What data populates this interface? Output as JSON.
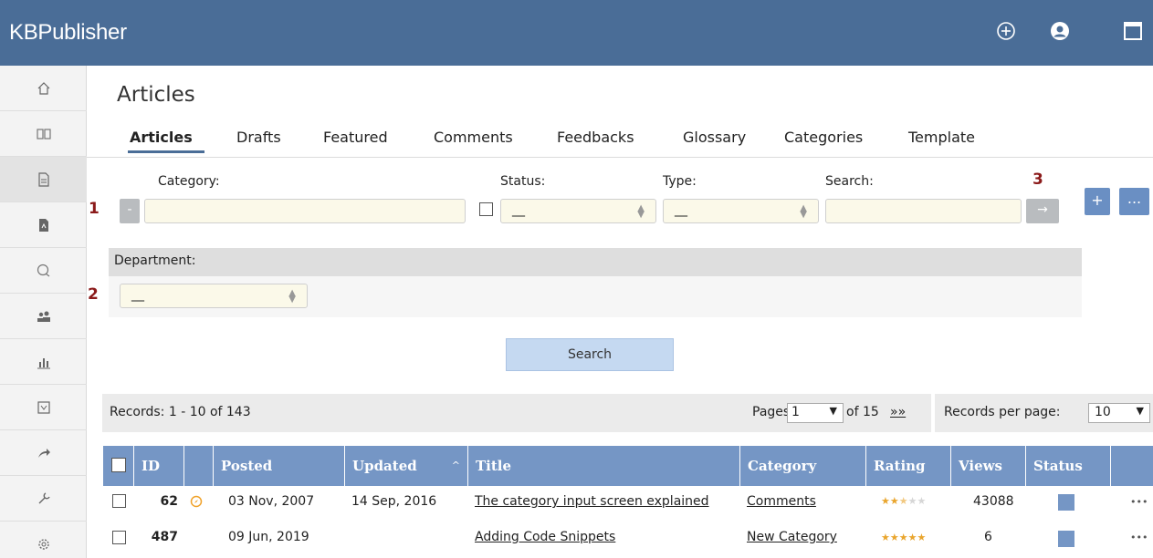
{
  "app": {
    "title": "KBPublisher"
  },
  "header": {
    "icons": [
      "plus-circle-icon",
      "user-icon",
      "window-icon"
    ]
  },
  "sidebar": {
    "items": [
      {
        "icon": "home-icon"
      },
      {
        "icon": "book-icon"
      },
      {
        "icon": "document-icon",
        "active": true
      },
      {
        "icon": "file-icon"
      },
      {
        "icon": "chat-icon"
      },
      {
        "icon": "users-icon"
      },
      {
        "icon": "chart-icon"
      },
      {
        "icon": "report-icon"
      },
      {
        "icon": "share-icon"
      },
      {
        "icon": "wrench-icon"
      },
      {
        "icon": "gear-icon"
      }
    ]
  },
  "page": {
    "title": "Articles",
    "tabs": [
      "Articles",
      "Drafts",
      "Featured",
      "Comments",
      "Feedbacks",
      "Glossary",
      "Categories",
      "Template"
    ],
    "active_tab": "Articles"
  },
  "filters": {
    "category_label": "Category:",
    "status_label": "Status:",
    "status_value": "__",
    "type_label": "Type:",
    "type_value": "__",
    "search_label": "Search:",
    "minus_label": "-",
    "go_label": "→",
    "add_label": "+",
    "more_label": "...",
    "department_label": "Department:",
    "department_value": "__",
    "search_button": "Search",
    "markers": [
      "1",
      "2",
      "3"
    ]
  },
  "pager": {
    "records_text": "Records: 1 - 10 of 143",
    "pages_label": "Pages:",
    "page_value": "1",
    "of_text": "of 15",
    "next_label": "»»",
    "rpp_label": "Records per page:",
    "rpp_value": "10"
  },
  "table": {
    "headers": [
      "ID",
      "Posted",
      "Updated",
      "Title",
      "Category",
      "Rating",
      "Views",
      "Status"
    ],
    "rows": [
      {
        "id": "62",
        "posted": "03 Nov, 2007",
        "updated": "14 Sep, 2016",
        "title": "The category input screen explained",
        "category": "Comments",
        "rating": 2.5,
        "views": "43088",
        "more": "•••"
      },
      {
        "id": "487",
        "posted": "09 Jun, 2019",
        "updated": "",
        "title": "Adding Code Snippets",
        "category": "New Category",
        "rating": 5,
        "views": "6",
        "more": "•••"
      }
    ]
  },
  "colors": {
    "header": "#4a6d97",
    "table_header": "#7596c5",
    "marker": "#8b1a1a",
    "input_bg": "#fbf9e9"
  }
}
